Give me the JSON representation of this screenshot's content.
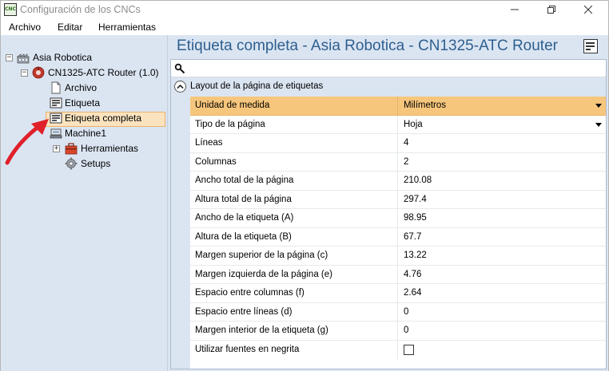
{
  "window": {
    "title": "Configuración de los CNCs",
    "app_icon_text": "CNC"
  },
  "menu": {
    "archivo": "Archivo",
    "editar": "Editar",
    "herramientas": "Herramientas"
  },
  "tree": {
    "root": "Asia Robotica",
    "machine": "CN1325-ATC Router (1.0)",
    "archivo": "Archivo",
    "etiqueta": "Etiqueta",
    "etiqueta_completa": "Etiqueta completa",
    "machine1": "Machine1",
    "herramientas": "Herramientas",
    "setups": "Setups"
  },
  "header": {
    "title": "Etiqueta completa - Asia Robotica - CN1325-ATC Router"
  },
  "search": {
    "value": "",
    "placeholder": ""
  },
  "category": {
    "label": "Layout de la página de etiquetas"
  },
  "properties": [
    {
      "name": "Unidad de medida",
      "value": "Milímetros"
    },
    {
      "name": "Tipo de la página",
      "value": "Hoja"
    },
    {
      "name": "Líneas",
      "value": "4"
    },
    {
      "name": "Columnas",
      "value": "2"
    },
    {
      "name": "Ancho total de la página",
      "value": "210.08"
    },
    {
      "name": "Altura total de la página",
      "value": "297.4"
    },
    {
      "name": "Ancho de la etiqueta (A)",
      "value": "98.95"
    },
    {
      "name": "Altura de la etiqueta (B)",
      "value": "67.7"
    },
    {
      "name": "Margen superior de la página (c)",
      "value": "13.22"
    },
    {
      "name": "Margen izquierda de la página (e)",
      "value": "4.76"
    },
    {
      "name": "Espacio entre columnas (f)",
      "value": "2.64"
    },
    {
      "name": "Espacio entre líneas (d)",
      "value": "0"
    },
    {
      "name": "Margen interior de la etiqueta (g)",
      "value": "0"
    },
    {
      "name": "Utilizar fuentes en negrita",
      "value": ""
    }
  ],
  "colors": {
    "accent_header": "#2e5f8f",
    "selection": "#f6c67c",
    "pane_bg": "#dbe5f2",
    "annotation_arrow": "#e0202a"
  },
  "icons": {
    "window_minimize": "minimize-icon",
    "window_maximize": "maximize-icon",
    "window_close": "close-icon"
  }
}
